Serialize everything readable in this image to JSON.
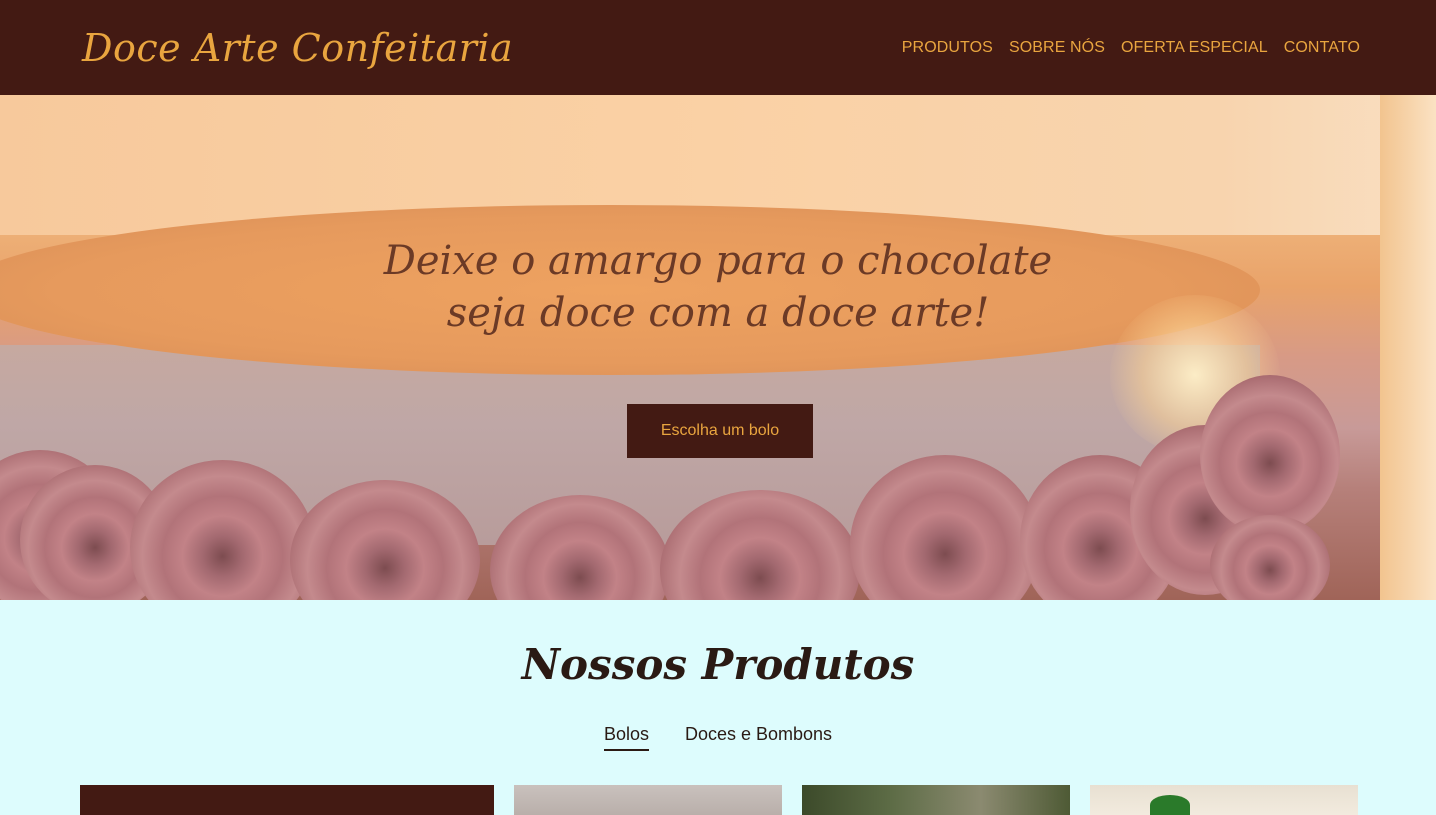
{
  "header": {
    "logo": "Doce Arte Confeitaria",
    "nav": [
      {
        "label": "PRODUTOS"
      },
      {
        "label": "SOBRE NÓS"
      },
      {
        "label": "OFERTA ESPECIAL"
      },
      {
        "label": "CONTATO"
      }
    ]
  },
  "hero": {
    "line1": "Deixe o amargo para o chocolate",
    "line2": "seja doce com a doce arte!",
    "button": "Escolha um bolo"
  },
  "products": {
    "title": "Nossos Produtos",
    "tabs": [
      {
        "label": "Bolos",
        "active": true
      },
      {
        "label": "Doces e Bombons",
        "active": false
      }
    ]
  },
  "colors": {
    "header_bg": "#431a13",
    "accent": "#e9a53f",
    "section_bg": "#ddfcfd"
  }
}
